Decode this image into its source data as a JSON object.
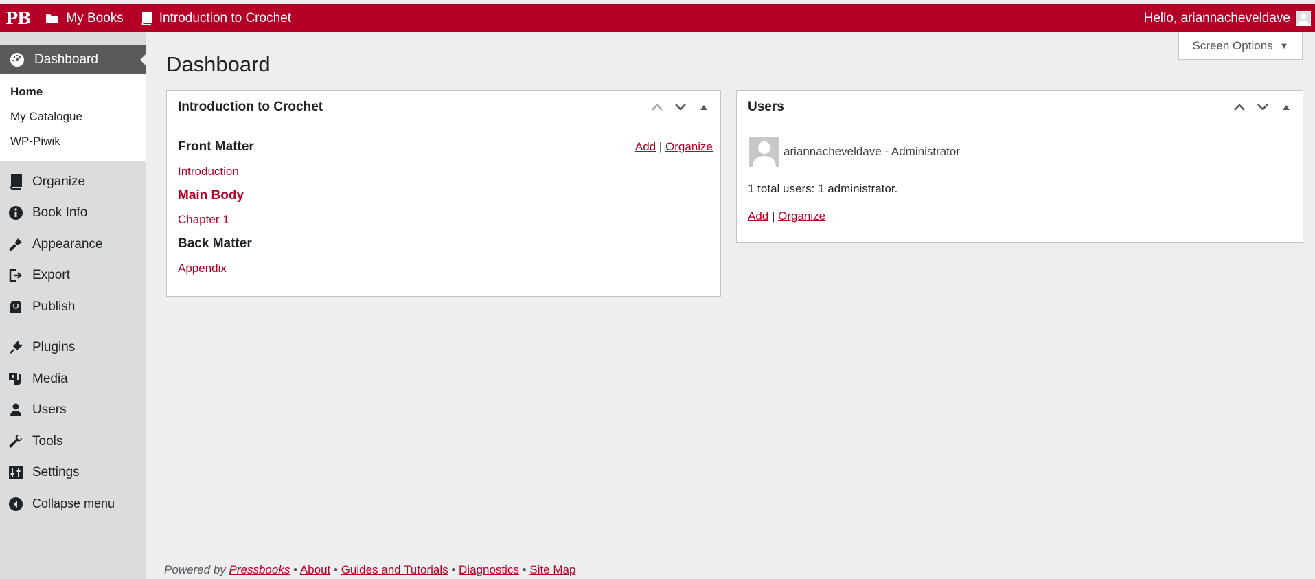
{
  "topbar": {
    "logo": "PB",
    "my_books": "My Books",
    "book_title": "Introduction to Crochet",
    "greeting": "Hello, ariannacheveldave",
    "color": "#b40026"
  },
  "sidebar": {
    "dashboard": "Dashboard",
    "submenu": [
      "Home",
      "My Catalogue",
      "WP-Piwik"
    ],
    "items": [
      {
        "label": "Organize",
        "icon": "book-icon"
      },
      {
        "label": "Book Info",
        "icon": "info-icon"
      },
      {
        "label": "Appearance",
        "icon": "brush-icon"
      },
      {
        "label": "Export",
        "icon": "export-icon"
      },
      {
        "label": "Publish",
        "icon": "store-icon"
      },
      {
        "label": "Plugins",
        "icon": "plug-icon"
      },
      {
        "label": "Media",
        "icon": "media-icon"
      },
      {
        "label": "Users",
        "icon": "user-icon"
      },
      {
        "label": "Tools",
        "icon": "wrench-icon"
      },
      {
        "label": "Settings",
        "icon": "settings-icon"
      },
      {
        "label": "Collapse menu",
        "icon": "collapse-icon"
      }
    ]
  },
  "main": {
    "title": "Dashboard",
    "screen_options": "Screen Options"
  },
  "book_box": {
    "title": "Introduction to Crochet",
    "add": "Add",
    "separator": "|",
    "organize": "Organize",
    "front_matter": "Front Matter",
    "introduction": "Introduction",
    "main_body": "Main Body",
    "chapter1": "Chapter 1",
    "back_matter": "Back Matter",
    "appendix": "Appendix"
  },
  "users_box": {
    "title": "Users",
    "user_line": "ariannacheveldave - Administrator",
    "count": "1 total users: 1 administrator.",
    "add": "Add",
    "separator": "|",
    "organize": "Organize"
  },
  "footer": {
    "powered_by": "Powered by",
    "pressbooks": "Pressbooks",
    "about": "About",
    "guides": "Guides and Tutorials",
    "diagnostics": "Diagnostics",
    "site_map": "Site Map",
    "bullet": "•"
  }
}
